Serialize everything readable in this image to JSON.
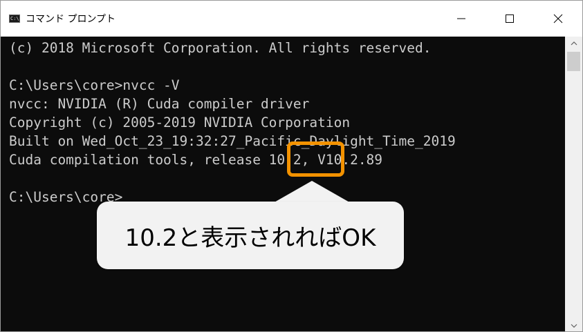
{
  "window": {
    "title": "コマンド プロンプト",
    "app_icon_text": "C:\\",
    "controls": {
      "minimize": "minimize-icon",
      "maximize": "maximize-icon",
      "close": "close-icon"
    }
  },
  "console": {
    "lines": [
      "(c) 2018 Microsoft Corporation. All rights reserved.",
      "",
      "C:\\Users\\core>nvcc -V",
      "nvcc: NVIDIA (R) Cuda compiler driver",
      "Copyright (c) 2005-2019 NVIDIA Corporation",
      "Built on Wed_Oct_23_19:32:27_Pacific_Daylight_Time_2019",
      "Cuda compilation tools, release 10.2, V10.2.89",
      "",
      "C:\\Users\\core>"
    ]
  },
  "annotation": {
    "callout_text": "10.2と表示されればOK",
    "highlight_color": "#f39200",
    "callout_bg": "#f2f2f2"
  },
  "colors": {
    "console_bg": "#0c0c0c",
    "console_text": "#cccccc",
    "titlebar_bg": "#ffffff"
  }
}
